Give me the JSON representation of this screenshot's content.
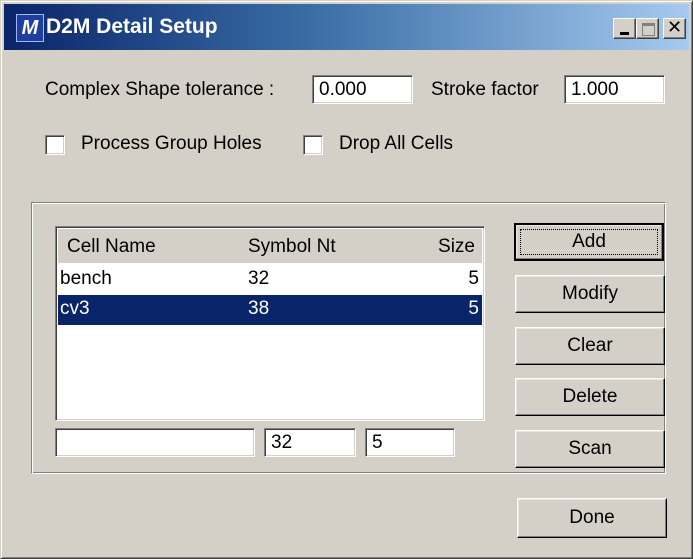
{
  "window": {
    "title": "D2M Detail Setup",
    "icon_letter": "M",
    "close_glyph": "✕"
  },
  "options": {
    "complex_shape_tolerance_label": "Complex Shape tolerance :",
    "complex_shape_tolerance_value": "0.000",
    "stroke_factor_label": "Stroke factor",
    "stroke_factor_value": "1.000",
    "process_group_holes_label": "Process Group Holes",
    "process_group_holes_checked": false,
    "drop_all_cells_label": "Drop All Cells",
    "drop_all_cells_checked": false
  },
  "cell_list": {
    "columns": [
      "Cell Name",
      "Symbol Nt",
      "Size"
    ],
    "rows": [
      {
        "name": "bench",
        "symbol": "32",
        "size": "5",
        "selected": false
      },
      {
        "name": "cv3",
        "symbol": "38",
        "size": "5",
        "selected": true
      }
    ]
  },
  "editor": {
    "name_value": "",
    "symbol_value": "32",
    "size_value": "5"
  },
  "buttons": {
    "add": "Add",
    "modify": "Modify",
    "clear": "Clear",
    "delete": "Delete",
    "scan": "Scan",
    "done": "Done"
  },
  "colors": {
    "selection": "#0a246a",
    "face": "#d4d0c8"
  }
}
